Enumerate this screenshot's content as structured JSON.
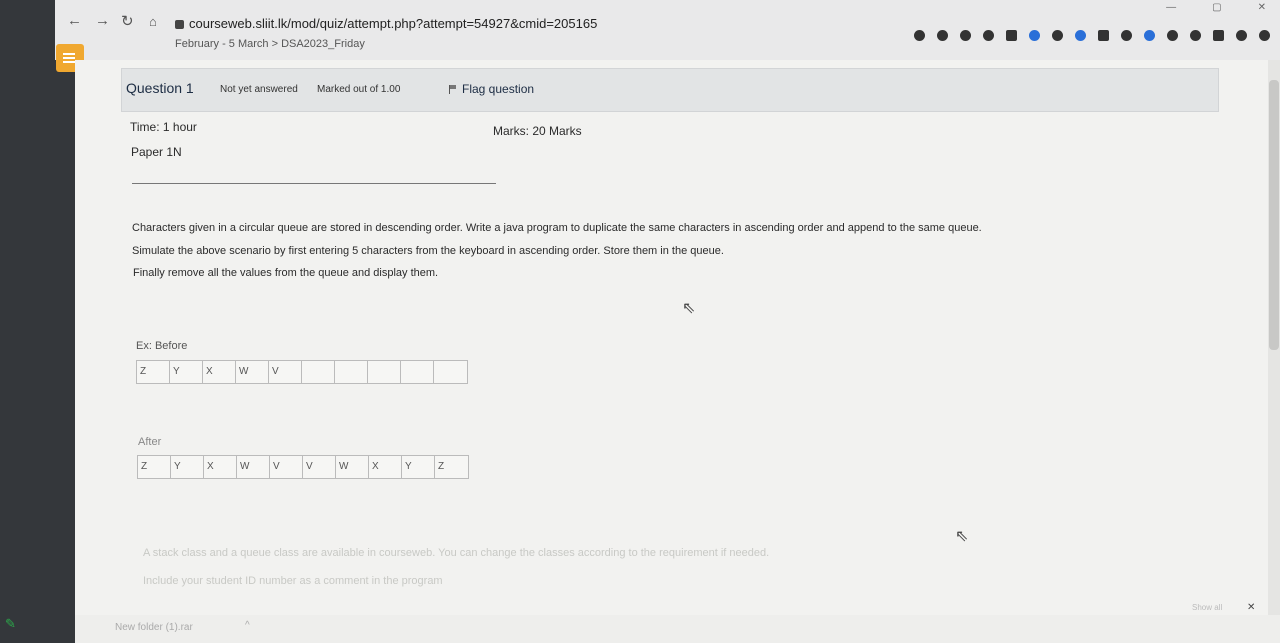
{
  "browser": {
    "url": "courseweb.sliit.lk/mod/quiz/attempt.php?attempt=54927&cmid=205165",
    "breadcrumb": "February - 5 March > DSA2023_Friday"
  },
  "question": {
    "number": "Question 1",
    "state": "Not yet answered",
    "marks_out_of": "Marked out of 1.00",
    "flag_label": "Flag question"
  },
  "content": {
    "time": "Time: 1 hour",
    "marks": "Marks: 20 Marks",
    "paper": "Paper 1N",
    "para1": "Characters given in a circular queue are stored in descending order. Write a java program to duplicate the same characters in ascending order and append to the same queue.",
    "para2": "Simulate the above scenario by first entering 5 characters from the keyboard in ascending order. Store them in the queue.",
    "para3": "Finally remove all the values from the queue and display them.",
    "before_label": "Ex: Before",
    "before_cells": [
      "Z",
      "Y",
      "X",
      "W",
      "V",
      "",
      "",
      "",
      "",
      ""
    ],
    "after_label": "After",
    "after_cells": [
      "Z",
      "Y",
      "X",
      "W",
      "V",
      "V",
      "W",
      "X",
      "Y",
      "Z"
    ],
    "note1": "A stack class and a queue class are available in courseweb. You can change the classes according to the requirement if needed.",
    "note2": "Include your student ID number as a comment in the program"
  },
  "downloads": {
    "file": "New folder (1).rar",
    "show_all": "Show all",
    "close": "✕"
  }
}
